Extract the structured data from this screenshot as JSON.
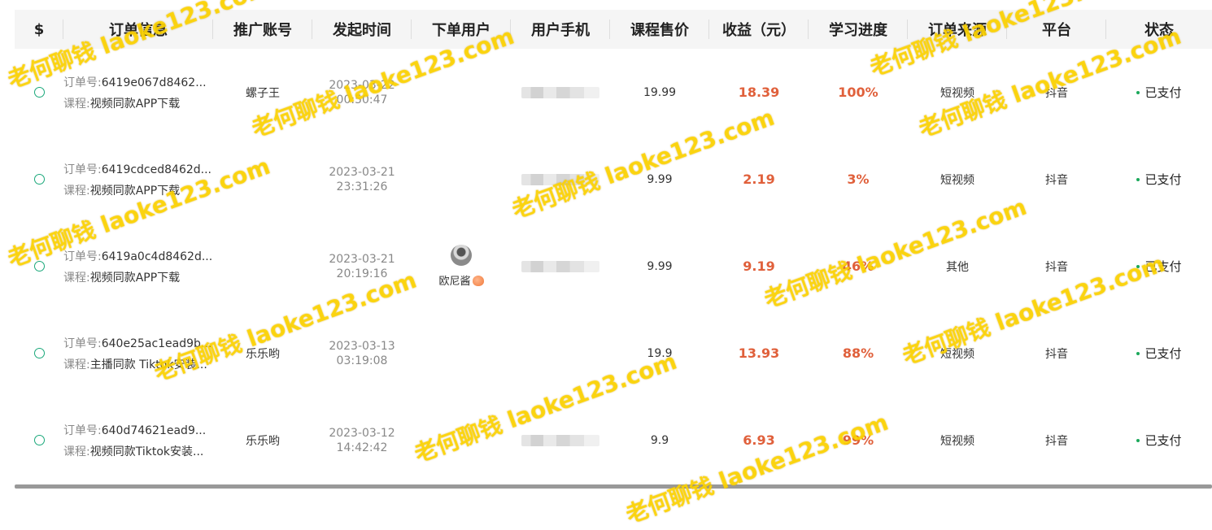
{
  "table": {
    "headers": [
      "$",
      "订单信息",
      "推广账号",
      "发起时间",
      "下单用户",
      "用户手机",
      "课程售价",
      "收益（元）",
      "学习进度",
      "订单来源",
      "平台",
      "状态"
    ],
    "rows": [
      {
        "order_label": "订单号:",
        "order_no": "6419e067d8462...",
        "course_label": "课程:",
        "course": "视频同款APP下载",
        "account": "螺子王",
        "date": "2023-03-22",
        "time": "00:50:47",
        "user": "",
        "price": "19.99",
        "income": "18.39",
        "progress": "100%",
        "source": "短视频",
        "platform": "抖音",
        "status": "已支付"
      },
      {
        "order_label": "订单号:",
        "order_no": "6419cdced8462d...",
        "course_label": "课程:",
        "course": "视频同款APP下载",
        "account": "",
        "date": "2023-03-21",
        "time": "23:31:26",
        "user": "",
        "price": "9.99",
        "income": "2.19",
        "progress": "3%",
        "source": "短视频",
        "platform": "抖音",
        "status": "已支付"
      },
      {
        "order_label": "订单号:",
        "order_no": "6419a0c4d8462d...",
        "course_label": "课程:",
        "course": "视频同款APP下载",
        "account": "",
        "date": "2023-03-21",
        "time": "20:19:16",
        "user": "欧尼酱",
        "price": "9.99",
        "income": "9.19",
        "progress": "46%",
        "source": "其他",
        "platform": "抖音",
        "status": "已支付"
      },
      {
        "order_label": "订单号:",
        "order_no": "640e25ac1ead9b...",
        "course_label": "课程:",
        "course": "主播同款 Tiktok安装...",
        "account": "乐乐哟",
        "date": "2023-03-13",
        "time": "03:19:08",
        "user": "",
        "price": "19.9",
        "income": "13.93",
        "progress": "88%",
        "source": "短视频",
        "platform": "抖音",
        "status": "已支付"
      },
      {
        "order_label": "订单号:",
        "order_no": "640d74621ead9...",
        "course_label": "课程:",
        "course": "视频同款Tiktok安装...",
        "account": "乐乐哟",
        "date": "2023-03-12",
        "time": "14:42:42",
        "user": "",
        "price": "9.9",
        "income": "6.93",
        "progress": "99%",
        "source": "短视频",
        "platform": "抖音",
        "status": "已支付"
      }
    ]
  },
  "watermark": "老何聊钱 laoke123.com",
  "colors": {
    "accent": "#1aa87a",
    "income": "#e0603b",
    "watermark": "#ffd600"
  }
}
